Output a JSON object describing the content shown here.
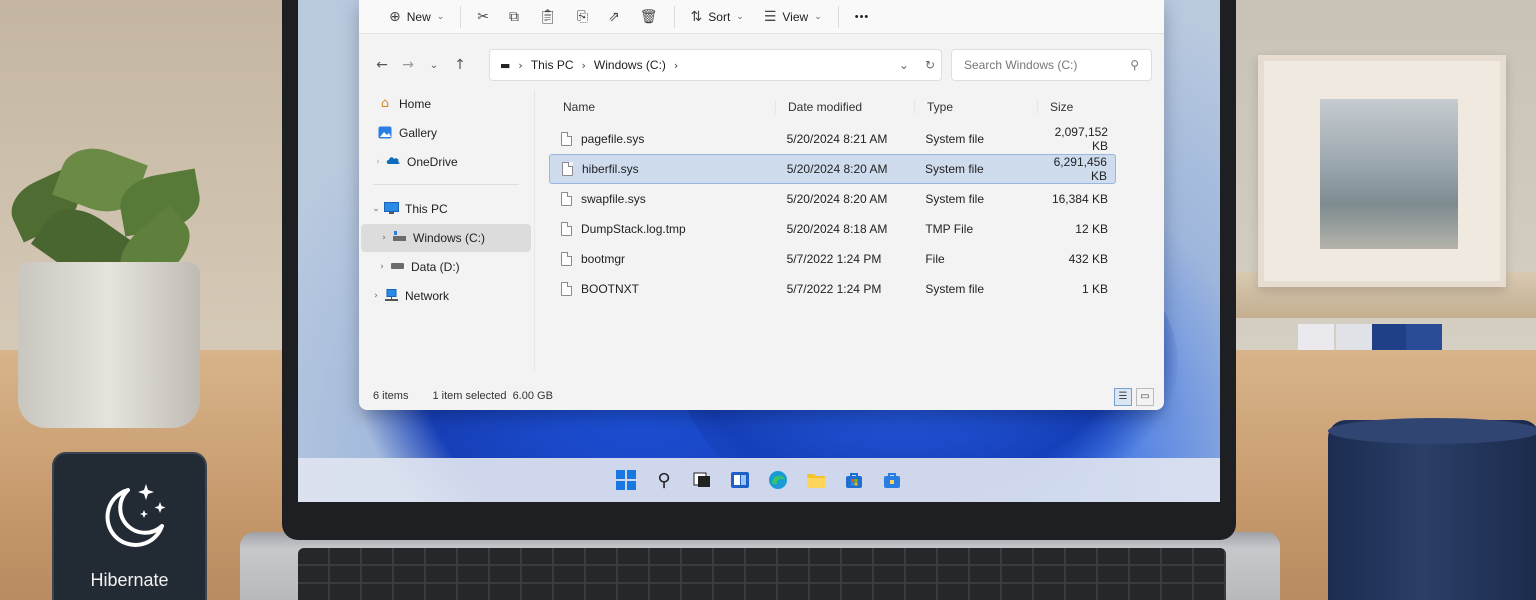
{
  "toolbar": {
    "new_label": "New",
    "sort_label": "Sort",
    "view_label": "View",
    "more_label": "•••"
  },
  "address": {
    "crumbs": [
      "This PC",
      "Windows (C:)"
    ],
    "search_placeholder": "Search Windows (C:)"
  },
  "nav": {
    "home": "Home",
    "gallery": "Gallery",
    "onedrive": "OneDrive",
    "thispc": "This PC",
    "windows_c": "Windows (C:)",
    "data_d": "Data (D:)",
    "network": "Network"
  },
  "columns": {
    "name": "Name",
    "date": "Date modified",
    "type": "Type",
    "size": "Size"
  },
  "files": [
    {
      "name": "pagefile.sys",
      "date": "5/20/2024 8:21 AM",
      "type": "System file",
      "size": "2,097,152 KB"
    },
    {
      "name": "hiberfil.sys",
      "date": "5/20/2024 8:20 AM",
      "type": "System file",
      "size": "6,291,456 KB"
    },
    {
      "name": "swapfile.sys",
      "date": "5/20/2024 8:20 AM",
      "type": "System file",
      "size": "16,384 KB"
    },
    {
      "name": "DumpStack.log.tmp",
      "date": "5/20/2024 8:18 AM",
      "type": "TMP File",
      "size": "12 KB"
    },
    {
      "name": "bootmgr",
      "date": "5/7/2022 1:24 PM",
      "type": "File",
      "size": "432 KB"
    },
    {
      "name": "BOOTNXT",
      "date": "5/7/2022 1:24 PM",
      "type": "System file",
      "size": "1 KB"
    }
  ],
  "selected_row_index": 1,
  "status": {
    "items": "6 items",
    "selected": "1 item selected  6.00 GB"
  },
  "badge": {
    "label": "Hibernate"
  },
  "colors": {
    "selection": "#cfdcee",
    "accent": "#0067c0",
    "badge_bg": "#222a33"
  }
}
